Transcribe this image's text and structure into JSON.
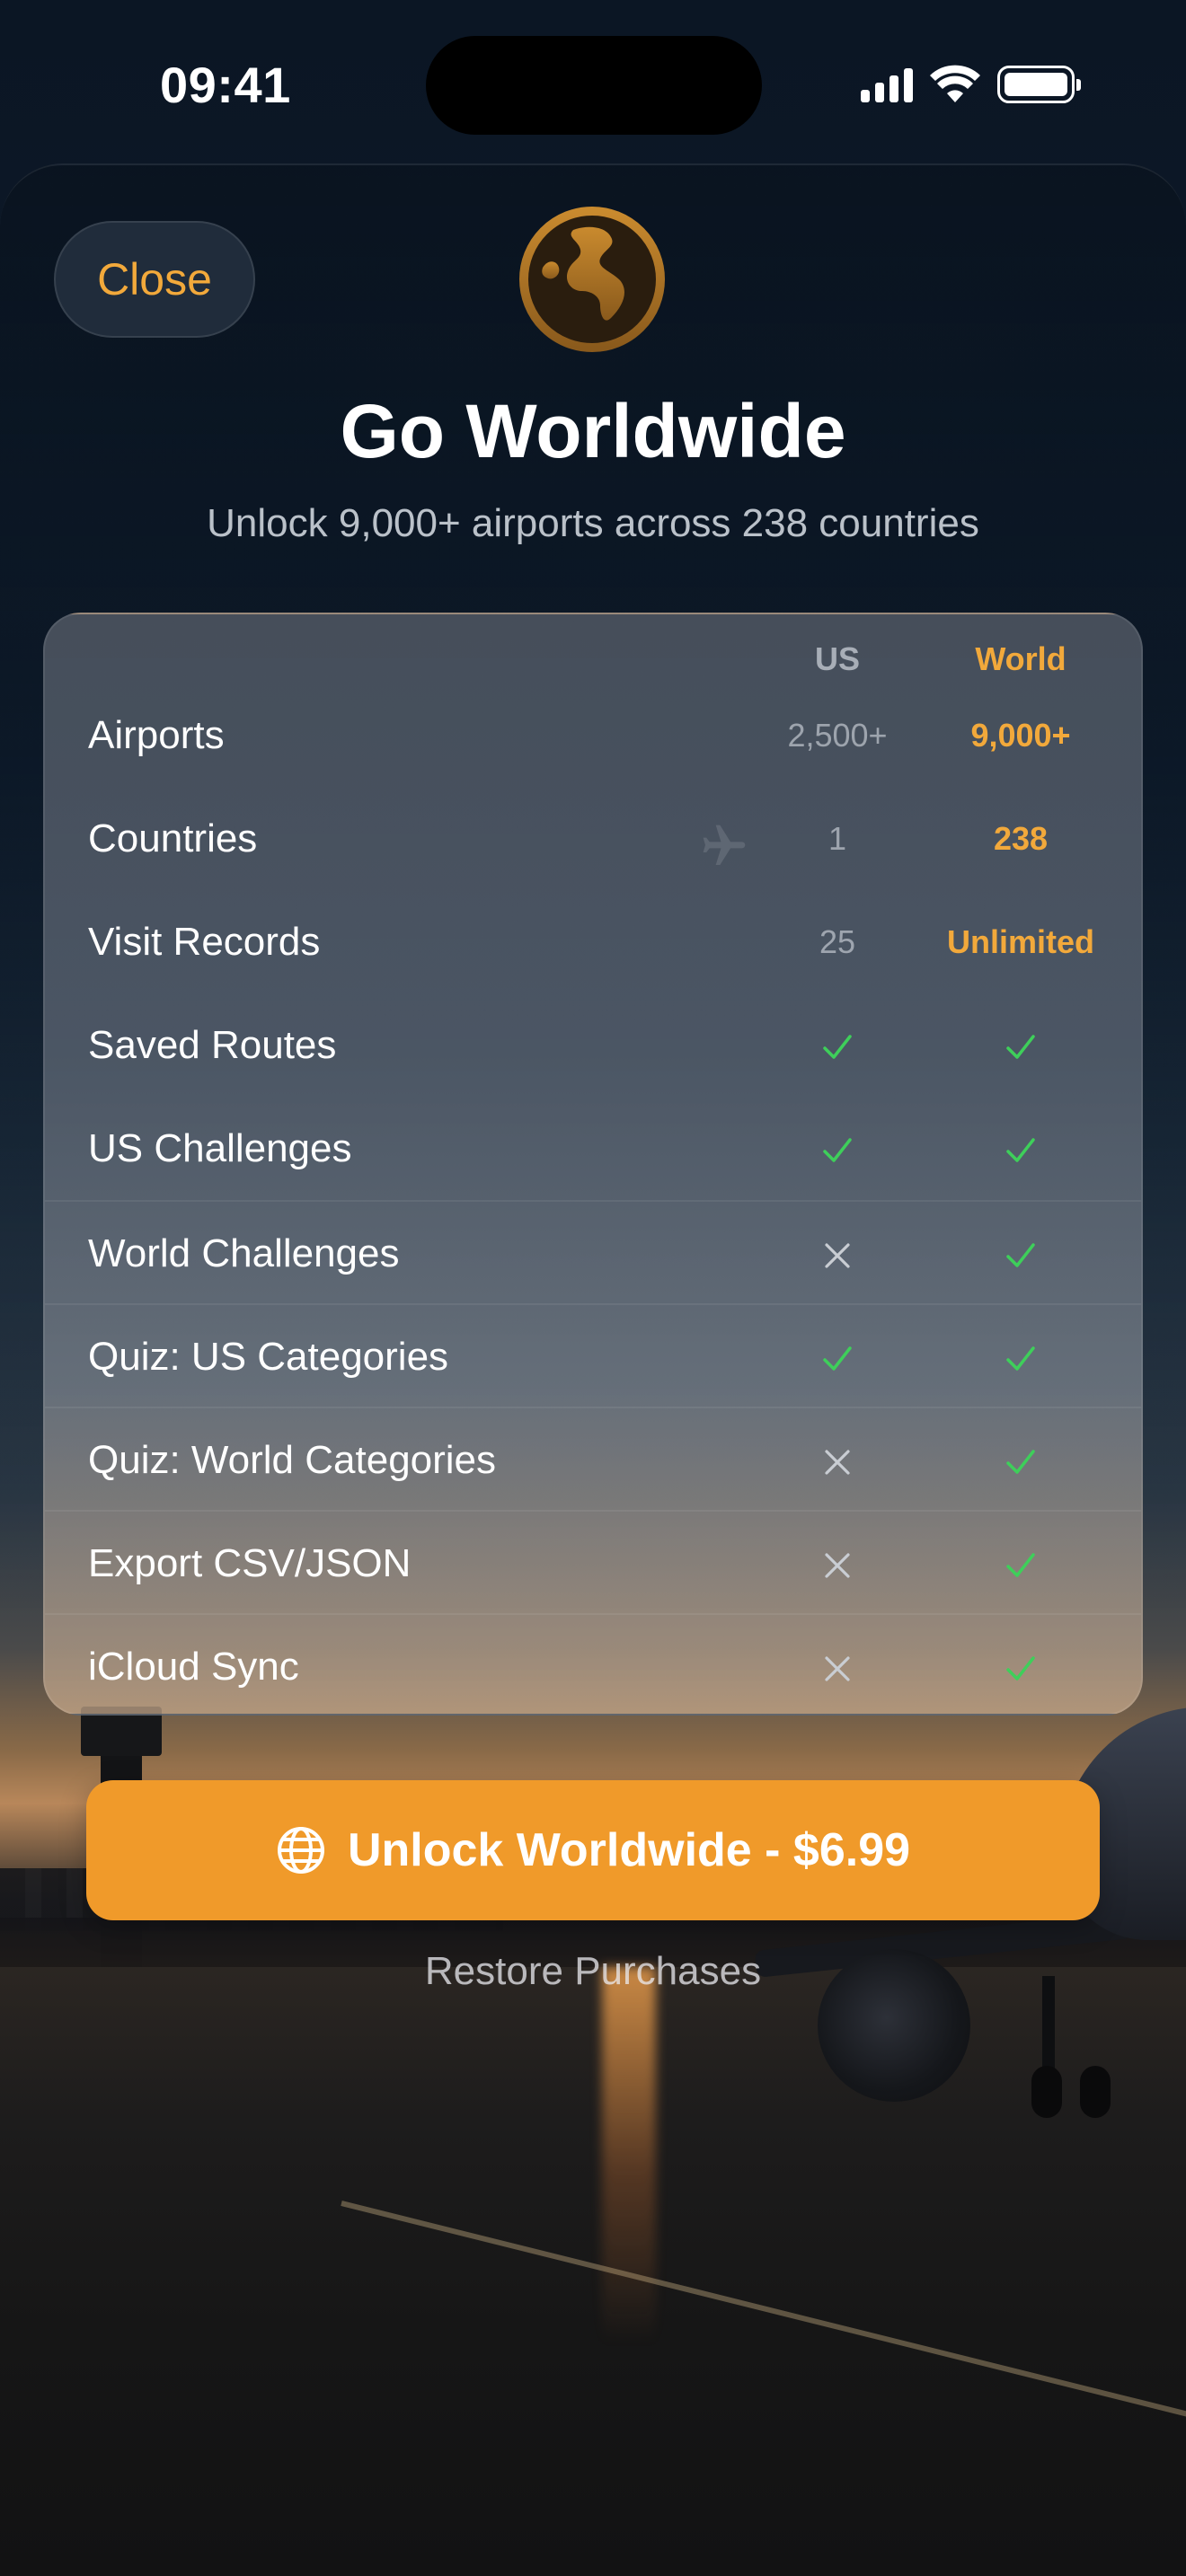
{
  "status_bar": {
    "time": "09:41"
  },
  "header": {
    "close_label": "Close",
    "title": "Go Worldwide",
    "subtitle": "Unlock 9,000+ airports across 238 countries"
  },
  "comparison": {
    "columns": [
      "US",
      "World"
    ],
    "rows": [
      {
        "label": "Airports",
        "us": "2,500+",
        "world": "9,000+"
      },
      {
        "label": "Countries",
        "us": "1",
        "world": "238"
      },
      {
        "label": "Visit Records",
        "us": "25",
        "world": "Unlimited"
      },
      {
        "label": "Saved Routes",
        "us": "check",
        "world": "check"
      },
      {
        "label": "US Challenges",
        "us": "check",
        "world": "check"
      },
      {
        "label": "World Challenges",
        "us": "cross",
        "world": "check"
      },
      {
        "label": "Quiz: US Categories",
        "us": "check",
        "world": "check"
      },
      {
        "label": "Quiz: World Categories",
        "us": "cross",
        "world": "check"
      },
      {
        "label": "Export CSV/JSON",
        "us": "cross",
        "world": "check"
      },
      {
        "label": "iCloud Sync",
        "us": "cross",
        "world": "check"
      }
    ]
  },
  "cta": {
    "label": "Unlock Worldwide - $6.99",
    "icon": "globe-icon"
  },
  "restore_label": "Restore Purchases",
  "colors": {
    "accent": "#f2a93b",
    "cta_background": "#f09a2a",
    "check": "#3ecf5a",
    "cross": "#c9cdd3"
  }
}
